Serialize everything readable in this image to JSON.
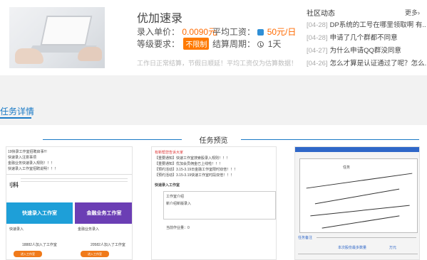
{
  "task": {
    "title": "优加速录",
    "unit_price_label": "录入单价：",
    "unit_price": "0.0090元",
    "avg_wage_label": "平均工资：",
    "avg_wage": "50元/日",
    "level_label": "等级要求：",
    "level_value": "不限制",
    "settle_label": "结算周期：",
    "settle_value": "1天",
    "note": "工作日正常结算，节假日顺延！平均工资仅为估算数据！"
  },
  "community": {
    "title": "社区动态",
    "more": "更多",
    "items": [
      {
        "date": "[04-28]",
        "text": "DP系统的工号在哪里领取啊 有..."
      },
      {
        "date": "[04-28]",
        "text": "申请了几个群都不同意"
      },
      {
        "date": "[04-27]",
        "text": "为什么申请QQ群没同意"
      },
      {
        "date": "[04-26]",
        "text": "怎么才算是认证通过了呢？怎么..."
      }
    ]
  },
  "details": {
    "tab": "任务详情",
    "preview_title": "任务预览"
  },
  "preview_cards": {
    "card1": {
      "line1": "19快录工作室招聘启事!!!",
      "line2": "快速录入注意事项",
      "line3": "金融业务快速录入规则！！！",
      "line4": "快速录入工作室招聘说明！！！",
      "logo": "刂科",
      "box1": "快速录入工作室",
      "box2": "金融业务工作室",
      "sub1": "快速录入",
      "sub2": "金融业务录入",
      "count1": "18882人加入了工作室",
      "count2": "20582人加入了工作室",
      "btn1": "进入工作室",
      "btn2": "进入工作室"
    },
    "card2": {
      "head": "有新帮您告诉大家",
      "n1": "【重要通知】快速工作室搜索股录入规则！！！",
      "n2": "【重要通知】优加会员佣金已上线啦！！！",
      "n3": "【预约活动】3.15-3.19日金融工作室限时双倍！！！",
      "n4": "【预约活动】3.15-3.19快速工作室时段双倍！！！",
      "section": "快速录入工作室",
      "memo_title": "工作室介绍",
      "memo_body": "新介绍新版录入",
      "footer": "当前作业量：0"
    },
    "card3": {
      "label1": "任务",
      "label2": "任务备注",
      "field1": "本次股份最多数量",
      "field2": "万元"
    }
  }
}
